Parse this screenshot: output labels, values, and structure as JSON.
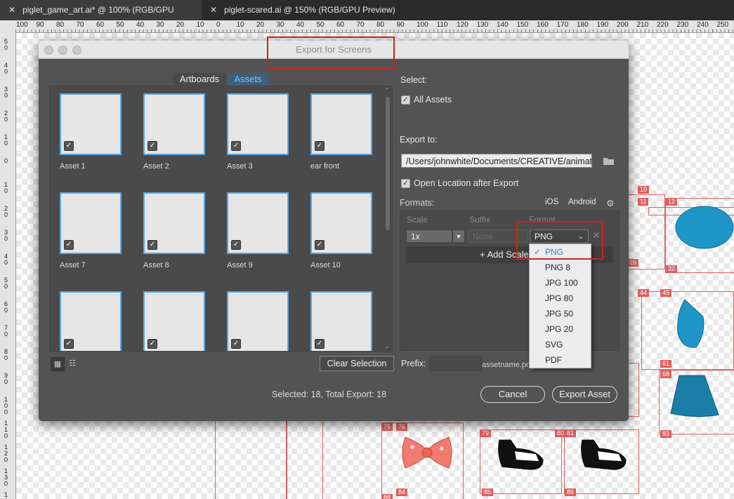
{
  "doc_tabs": [
    {
      "close": "✕",
      "label": "piglet_game_art.ai* @ 100% (RGB/GPU Preview)"
    },
    {
      "close": "✕",
      "label": "piglet-scared.ai @ 150% (RGB/GPU Preview)"
    }
  ],
  "ruler_labels": [
    "100",
    "90",
    "80",
    "70",
    "60",
    "50",
    "40",
    "30",
    "20",
    "10",
    "0",
    "10",
    "20",
    "30",
    "40",
    "50",
    "60",
    "70",
    "80",
    "90",
    "100",
    "110",
    "120",
    "130",
    "140",
    "150",
    "160",
    "170",
    "180",
    "190",
    "200",
    "210",
    "220",
    "230",
    "240",
    "250"
  ],
  "ruler_v_labels": [
    "5 0",
    "4 0",
    "3 0",
    "2 0",
    "1 0",
    "0",
    "1 0",
    "2 0",
    "3 0",
    "4 0",
    "5 0",
    "6 0",
    "7 0",
    "8 0",
    "9 0",
    "1 0 0",
    "1 1 0",
    "1 2 0",
    "1 3 0",
    "1 4 0"
  ],
  "artboard_labels": [
    "10",
    "11",
    "12",
    "32",
    "44",
    "45",
    "61",
    "68",
    "83",
    "26",
    "75",
    "76",
    "79",
    "80",
    "81",
    "85",
    "86",
    "84",
    "88"
  ],
  "dialog": {
    "title": "Export for Screens",
    "tabs": {
      "artboards": "Artboards",
      "assets": "Assets"
    },
    "assets": [
      {
        "label": "Asset 1",
        "checked": true
      },
      {
        "label": "Asset 2",
        "checked": true
      },
      {
        "label": "Asset 3",
        "checked": true
      },
      {
        "label": "ear front",
        "checked": true
      },
      {
        "label": "Asset 7",
        "checked": true
      },
      {
        "label": "Asset 8",
        "checked": true
      },
      {
        "label": "Asset 9",
        "checked": true
      },
      {
        "label": "Asset 10",
        "checked": true
      },
      {
        "label": "",
        "checked": true
      },
      {
        "label": "",
        "checked": true
      },
      {
        "label": "",
        "checked": true
      },
      {
        "label": "",
        "checked": true
      }
    ],
    "clear_selection": "Clear Selection",
    "status": "Selected: 18, Total Export: 18",
    "select_label": "Select:",
    "all_assets": "All Assets",
    "export_to_label": "Export to:",
    "export_path": "/Users/johnwhite/Documents/CREATIVE/animation",
    "open_location": "Open Location after Export",
    "formats_label": "Formats:",
    "ios": "iOS",
    "android": "Android",
    "columns": {
      "scale": "Scale",
      "suffix": "Suffix",
      "format": "Format"
    },
    "scale_value": "1x",
    "suffix_placeholder": "None",
    "format_value": "PNG",
    "add_scale": "+ Add Scale",
    "prefix_label": "Prefix:",
    "prefix_value": "",
    "filename_preview": "assetname.png",
    "cancel": "Cancel",
    "export_asset": "Export Asset",
    "format_options": [
      "PNG",
      "PNG 8",
      "JPG 100",
      "JPG 80",
      "JPG 50",
      "JPG 20",
      "SVG",
      "PDF"
    ],
    "selected_format": "PNG",
    "check_glyph": "✓",
    "folder_icon": "folder-icon",
    "gear_icon": "gear-icon"
  },
  "colors": {
    "accent": "#5aa8e8",
    "annotation": "#d42020",
    "artboard": "#e06060"
  }
}
